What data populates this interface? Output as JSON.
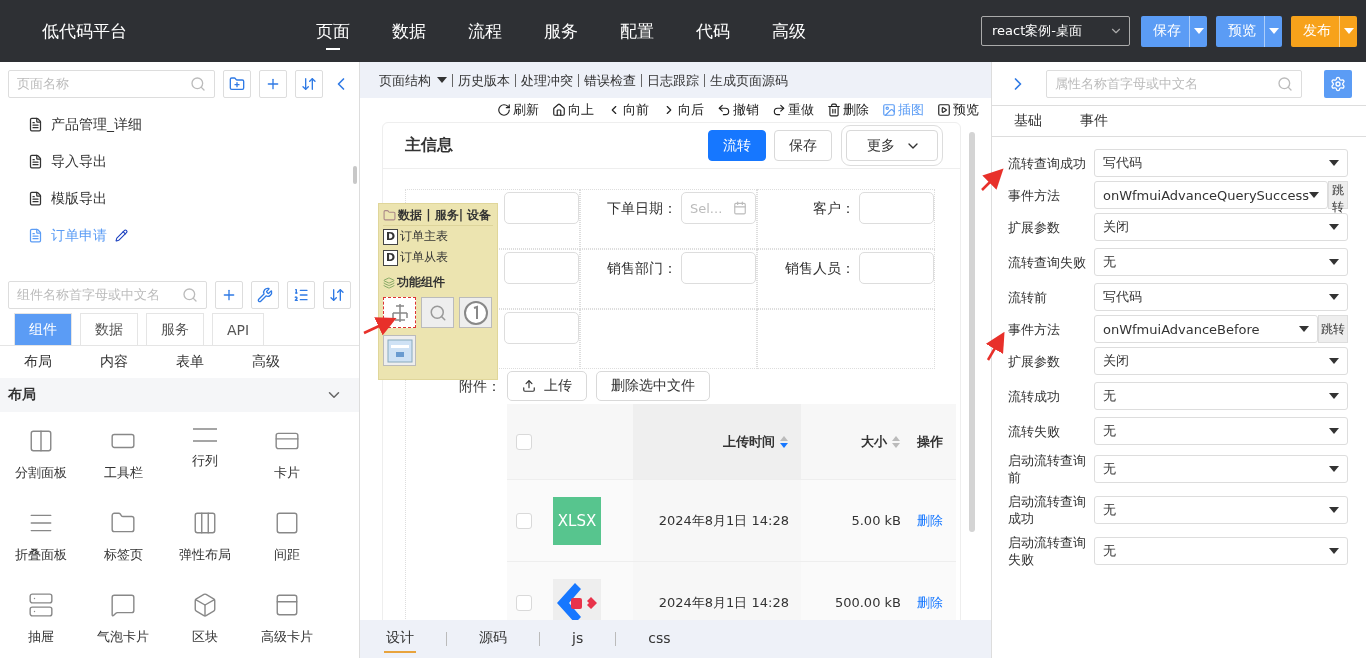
{
  "app": {
    "title": "低代码平台"
  },
  "nav": [
    {
      "label": "页面",
      "selected": true
    },
    {
      "label": "数据",
      "selected": false
    },
    {
      "label": "流程",
      "selected": false
    },
    {
      "label": "服务",
      "selected": false
    },
    {
      "label": "配置",
      "selected": false
    },
    {
      "label": "代码",
      "selected": false
    },
    {
      "label": "高级",
      "selected": false
    }
  ],
  "project_select": {
    "value": "react案例-桌面"
  },
  "actions": [
    {
      "label": "保存",
      "kind": "primary"
    },
    {
      "label": "预览",
      "kind": "primary"
    },
    {
      "label": "发布",
      "kind": "warning"
    }
  ],
  "left": {
    "page_search": {
      "placeholder": "页面名称"
    },
    "pages": [
      {
        "label": "产品管理_详细",
        "selected": false
      },
      {
        "label": "导入导出",
        "selected": false
      },
      {
        "label": "模版导出",
        "selected": false
      },
      {
        "label": "订单申请",
        "selected": true
      }
    ],
    "component_search": {
      "placeholder": "组件名称首字母或中文名"
    },
    "tabs": [
      {
        "label": "组件",
        "selected": true
      },
      {
        "label": "数据",
        "selected": false
      },
      {
        "label": "服务",
        "selected": false
      },
      {
        "label": "API",
        "selected": false
      }
    ],
    "categories": [
      "布局",
      "内容",
      "表单",
      "高级"
    ],
    "section": {
      "title": "布局",
      "expanded": true
    },
    "components": [
      "分割面板",
      "工具栏",
      "行列",
      "卡片",
      "折叠面板",
      "标签页",
      "弹性布局",
      "间距",
      "抽屉",
      "气泡卡片",
      "区块",
      "高级卡片"
    ]
  },
  "center": {
    "structure_menu": "页面结构",
    "menu": [
      "历史版本",
      "处理冲突",
      "错误检查",
      "日志跟踪",
      "生成页面源码"
    ],
    "tools": [
      {
        "label": "刷新",
        "active": false
      },
      {
        "label": "向上",
        "active": false
      },
      {
        "label": "向前",
        "active": false
      },
      {
        "label": "向后",
        "active": false
      },
      {
        "label": "撤销",
        "active": false
      },
      {
        "label": "重做",
        "active": false
      },
      {
        "label": "删除",
        "active": false
      },
      {
        "label": "插图",
        "active": true
      },
      {
        "label": "预览",
        "active": false
      }
    ],
    "card": {
      "title": "主信息",
      "buttons": [
        {
          "label": "流转",
          "kind": "primary"
        },
        {
          "label": "保存",
          "kind": "default"
        },
        {
          "label": "更多",
          "kind": "dropdown"
        }
      ]
    },
    "form_rows": [
      [
        {
          "kind": "text"
        },
        {
          "label": "下单日期：",
          "kind": "date",
          "placeholder": "Sel..."
        },
        {
          "label": "客户：",
          "kind": "text"
        }
      ],
      [
        {
          "kind": "text"
        },
        {
          "label": "销售部门：",
          "kind": "text"
        },
        {
          "label": "销售人员：",
          "kind": "text"
        }
      ],
      [
        {
          "kind": "text"
        }
      ]
    ],
    "attachments": {
      "label": "附件：",
      "upload": "上传",
      "delete": "删除选中文件",
      "header_checked": false,
      "columns": [
        {
          "label": "上传时间",
          "sortable": true,
          "sorted": true
        },
        {
          "label": "大小",
          "sortable": true,
          "sorted": false
        },
        {
          "label": "操作",
          "sortable": false
        }
      ],
      "rows": [
        {
          "checked": false,
          "kind": "xlsx",
          "thumb_label": "XLSX",
          "time": "2024年8月1日 14:28",
          "size": "5.00 kB",
          "action": "删除"
        },
        {
          "checked": false,
          "kind": "app",
          "time": "2024年8月1日 14:28",
          "size": "500.00 kB",
          "action": "删除"
        }
      ]
    },
    "bottom_tabs": [
      {
        "label": "设计",
        "selected": true
      },
      {
        "label": "源码",
        "selected": false
      },
      {
        "label": "js",
        "selected": false
      },
      {
        "label": "css",
        "selected": false
      }
    ],
    "palette": {
      "title": "数据 | 服务| 设备",
      "tables": [
        {
          "badge": "D",
          "label": "订单主表"
        },
        {
          "badge": "D",
          "label": "订单从表"
        }
      ],
      "section": "功能组件",
      "tools": [
        {
          "selected": true
        },
        {
          "selected": false
        },
        {
          "selected": false
        },
        {
          "selected": false
        }
      ]
    }
  },
  "right": {
    "search": {
      "placeholder": "属性名称首字母或中文名"
    },
    "tabs": [
      "基础",
      "事件"
    ],
    "groups": [
      [
        {
          "label": "流转查询成功",
          "value": "写代码"
        },
        {
          "label": "事件方法",
          "value": "onWfmuiAdvanceQuerySuccess",
          "jump": "跳转"
        },
        {
          "label": "扩展参数",
          "value": "关闭"
        }
      ],
      [
        {
          "label": "流转查询失败",
          "value": "无"
        }
      ],
      [
        {
          "label": "流转前",
          "value": "写代码"
        },
        {
          "label": "事件方法",
          "value": "onWfmuiAdvanceBefore",
          "jump": "跳转"
        },
        {
          "label": "扩展参数",
          "value": "关闭"
        }
      ],
      [
        {
          "label": "流转成功",
          "value": "无"
        }
      ],
      [
        {
          "label": "流转失败",
          "value": "无"
        }
      ],
      [
        {
          "label": "启动流转查询前",
          "value": "无"
        }
      ],
      [
        {
          "label": "启动流转查询成功",
          "value": "无"
        }
      ],
      [
        {
          "label": "启动流转查询失败",
          "value": "无"
        }
      ]
    ]
  }
}
